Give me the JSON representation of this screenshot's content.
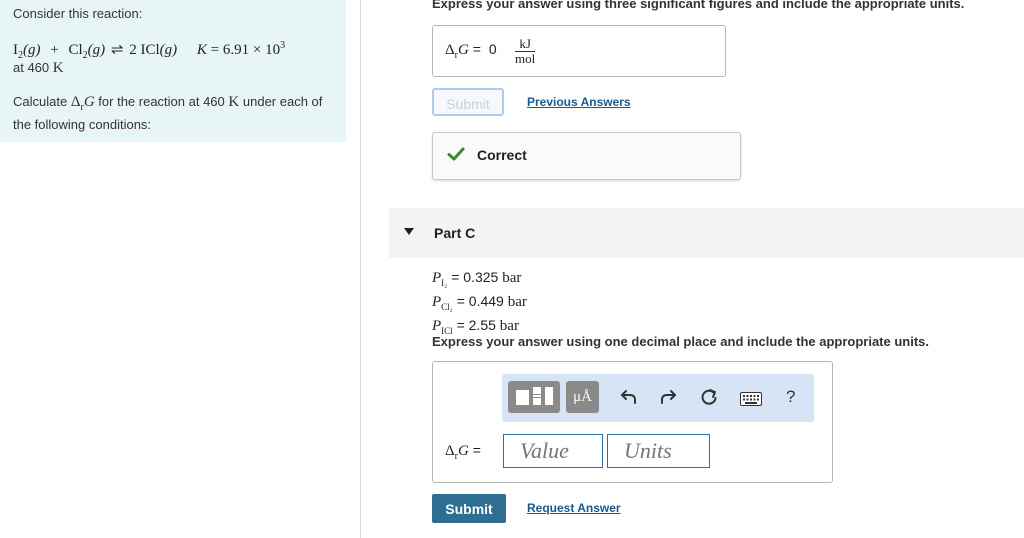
{
  "problem": {
    "consider": "Consider this reaction:",
    "reaction": {
      "reactant1": "I",
      "reactant1_sub": "2",
      "reactant1_phase": "(g)",
      "plus": "+",
      "reactant2": "Cl",
      "reactant2_sub": "2",
      "reactant2_phase": "(g)",
      "arrow": "⇌",
      "product": "2 ICl",
      "product_phase": "(g)",
      "k_label": "K",
      "k_value": "= 6.91 × 10",
      "k_exp": "3"
    },
    "temp_prefix": "at 460",
    "temp_unit": "K",
    "calc_prefix": "Calculate",
    "calc_delta": "Δ",
    "calc_sub": "r",
    "calc_g": "G",
    "calc_mid": "for the reaction at 460",
    "calc_unit": "K",
    "calc_suffix": "under each of the following conditions:"
  },
  "part_b": {
    "instruction": "Express your answer using three significant figures and include the appropriate units.",
    "answer_label_delta": "Δ",
    "answer_label_sub": "r",
    "answer_label_g": "G",
    "answer_label_eq": " = ",
    "answer_value": "0",
    "unit_num": "kJ",
    "unit_den": "mol",
    "submit_label": "Submit",
    "previous_answers": "Previous Answers",
    "feedback": "Correct"
  },
  "part_c": {
    "title": "Part C",
    "pressures": [
      {
        "symbol": "P",
        "sub": "I₂",
        "value": "= 0.325",
        "unit": "bar"
      },
      {
        "symbol": "P",
        "sub": "Cl₂",
        "value": "= 0.449",
        "unit": "bar"
      },
      {
        "symbol": "P",
        "sub": "ICl",
        "value": "= 2.55",
        "unit": "bar"
      }
    ],
    "instruction": "Express your answer using one decimal place and include the appropriate units.",
    "units_button": "μÅ",
    "help": "?",
    "answer_label_delta": "Δ",
    "answer_label_sub": "r",
    "answer_label_g": "G",
    "answer_label_eq": " = ",
    "value_placeholder": "Value",
    "units_placeholder": "Units",
    "submit_label": "Submit",
    "request_answer": "Request Answer"
  },
  "colors": {
    "left_panel_bg": "#e8f5f7",
    "submit_bg": "#2e6e93",
    "link": "#1a5a8f",
    "correct_check": "#3c8a2e",
    "toolbar_bg": "#d6e4f5"
  },
  "icons": [
    "templates-icon",
    "units-icon",
    "undo-icon",
    "redo-icon",
    "reset-icon",
    "keyboard-icon",
    "help-icon",
    "checkmark-icon",
    "collapse-triangle-icon"
  ]
}
